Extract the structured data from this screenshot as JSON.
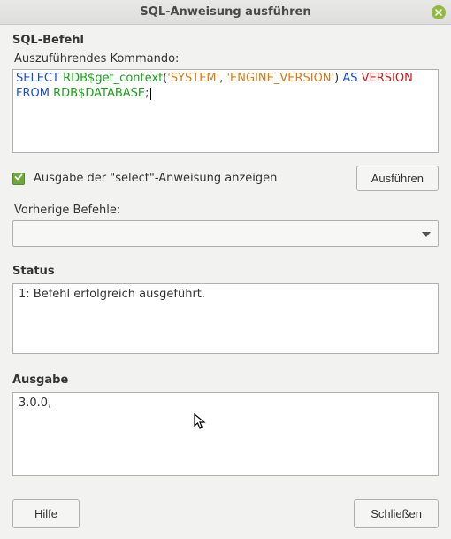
{
  "window": {
    "title": "SQL-Anweisung ausführen"
  },
  "sql_section": {
    "title": "SQL-Befehl",
    "command_label": "Auszuführendes Kommando:",
    "sql": {
      "select": "SELECT",
      "fn": "RDB$get_context",
      "p1": "'SYSTEM'",
      "comma": ", ",
      "p2": "'ENGINE_VERSION'",
      "as": "AS",
      "alias": "VERSION",
      "from": "FROM",
      "tbl": "RDB$DATABASE",
      "semi": ";"
    },
    "show_output_label": "Ausgabe der \"select\"-Anweisung anzeigen",
    "execute_label": "Ausführen",
    "prev_label": "Vorherige Befehle:",
    "prev_value": ""
  },
  "status": {
    "title": "Status",
    "text": "1: Befehl erfolgreich ausgeführt."
  },
  "output": {
    "title": "Ausgabe",
    "text": "3.0.0,"
  },
  "footer": {
    "help": "Hilfe",
    "close": "Schließen"
  }
}
